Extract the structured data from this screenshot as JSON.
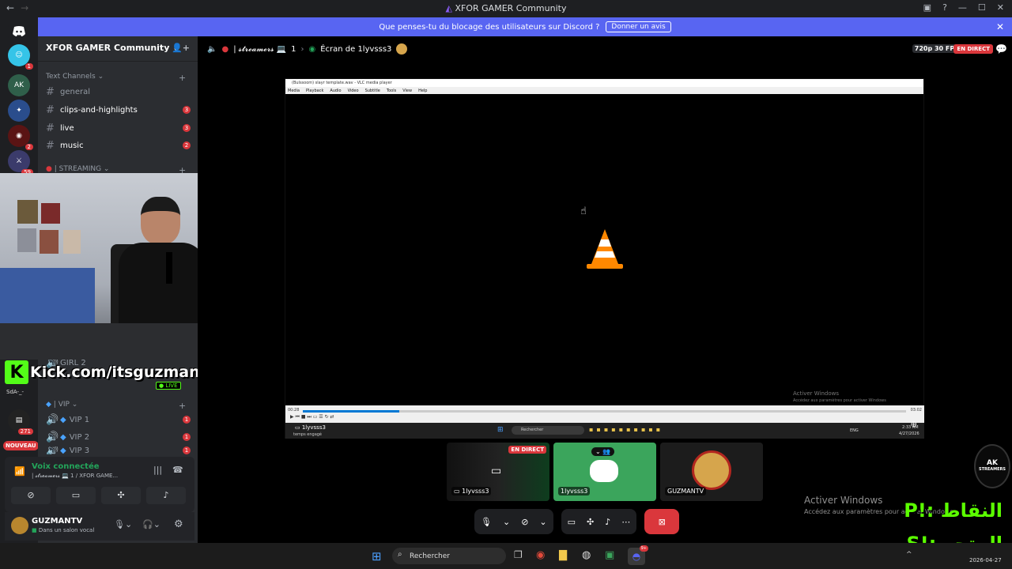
{
  "window": {
    "title": "XFOR GAMER Community"
  },
  "banner": {
    "text": "Que penses-tu du blocage des utilisateurs sur Discord ?",
    "button": "Donner un avis"
  },
  "guilds": {
    "badges": [
      "1",
      "2",
      "59",
      "271"
    ],
    "new_label": "NOUVEAU",
    "user_label": "SdA-_-"
  },
  "server": {
    "name": "XFOR GAMER Community"
  },
  "categories": {
    "text": "Text Channels",
    "streaming": "| STREAMING",
    "vip": "| VIP"
  },
  "channels": [
    {
      "name": "general",
      "badge": ""
    },
    {
      "name": "clips-and-highlights",
      "badge": "3"
    },
    {
      "name": "live",
      "badge": "3"
    },
    {
      "name": "music",
      "badge": "2"
    }
  ],
  "voice_channels": [
    {
      "name": "GIRL 2",
      "badge": ""
    },
    {
      "name": "VIP 1",
      "badge": "1"
    },
    {
      "name": "VIP 2",
      "badge": "1"
    },
    {
      "name": "VIP 3",
      "badge": "1"
    }
  ],
  "overlay": {
    "kick": "Kick.com/itsguzmantv",
    "live": "LIVE"
  },
  "voice": {
    "status": "Voix connectée",
    "channel": "| 𝓼𝓽𝓻𝓮𝓪𝓶𝓮𝓻𝓼 💻 1 / XFOR GAME..."
  },
  "user": {
    "name": "GUZMANTV",
    "status": "Dans un salon vocal"
  },
  "topbar": {
    "channel": "| 𝓼𝓽𝓻𝓮𝓪𝓶𝓮𝓻𝓼 💻",
    "count": "1",
    "screen": "Écran de 1lyvsss3",
    "quality": "720p 30 FPS",
    "live": "EN DIRECT"
  },
  "vlc": {
    "title": "(Bulssoom) slayr template.wav - VLC media player",
    "menu": [
      "Media",
      "Playback",
      "Audio",
      "Video",
      "Subtitle",
      "Tools",
      "View",
      "Help"
    ],
    "time_start": "00:28",
    "time_end": "03:02",
    "progress": 0.16,
    "activate": "Activer Windows",
    "activate_sub": "Accédez aux paramètres pour activer Windows",
    "taskbar_search": "Rechercher",
    "taskbar_user": "1lyvsss3",
    "taskbar_status": "temps engagé",
    "taskbar_lang": "ENG",
    "taskbar_time": "2:33 AM",
    "taskbar_date": "4/27/2026"
  },
  "tiles": [
    {
      "name": "1lyvsss3",
      "badge": "EN DIRECT"
    },
    {
      "name": "1lyvsss3"
    },
    {
      "name": "GUZMANTV"
    }
  ],
  "watermark": {
    "title": "Activer Windows",
    "sub": "Accédez aux paramètres pour activer Windows."
  },
  "arabic": {
    "line1": "النقاط :!P",
    "line2": "المتجر :!S"
  },
  "ak_logo": {
    "text": "AK",
    "sub": "STREAMERS"
  },
  "taskbar": {
    "search": "Rechercher",
    "notification_count": "9+",
    "date": "2026-04-27"
  }
}
